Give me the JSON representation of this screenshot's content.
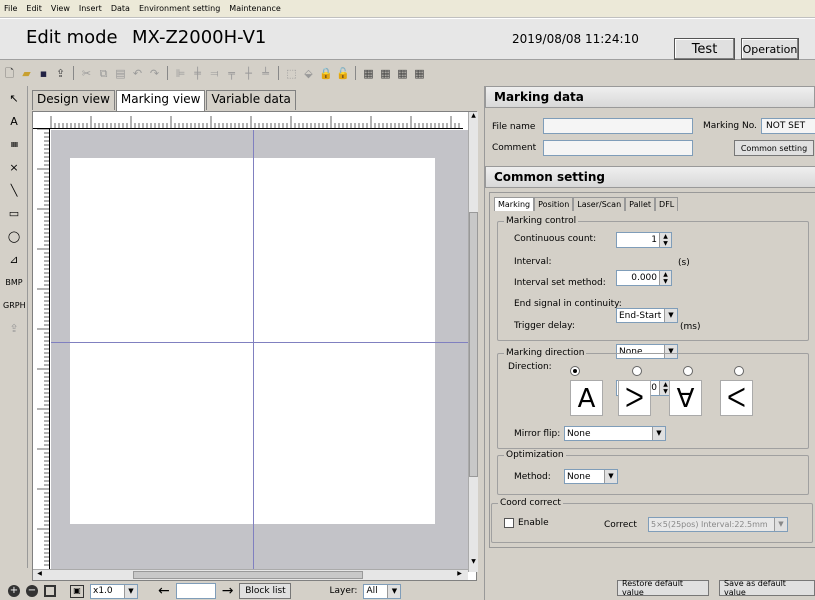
{
  "menu": [
    "File",
    "Edit",
    "View",
    "Insert",
    "Data",
    "Environment setting",
    "Maintenance"
  ],
  "header": {
    "mode": "Edit mode",
    "model": "MX-Z2000H-V1",
    "datetime": "2019/08/08 11:24:10",
    "test_label": "Test",
    "operation_label": "Operation"
  },
  "left_tools": [
    "A",
    "IIIIII",
    "×",
    "╲",
    "▭",
    "◯",
    "⊿",
    "BMP",
    "GRPH"
  ],
  "view_tabs": [
    "Design view",
    "Marking view",
    "Variable data"
  ],
  "bottom": {
    "zoom": "x1.0",
    "block_list_label": "Block list",
    "layer_label": "Layer:",
    "layer_value": "All"
  },
  "marking_data": {
    "title": "Marking data",
    "file_name_label": "File name",
    "file_name_value": "",
    "marking_no_label": "Marking No.",
    "marking_no_value": "NOT SET",
    "comment_label": "Comment",
    "comment_value": "",
    "common_setting_button": "Common setting"
  },
  "common_setting": {
    "title": "Common setting",
    "tabs": [
      "Marking",
      "Position",
      "Laser/Scan",
      "Pallet",
      "DFL"
    ],
    "marking_control": {
      "title": "Marking control",
      "continuous_count_label": "Continuous count:",
      "continuous_count_value": "1",
      "interval_label": "Interval:",
      "interval_value": "0.000",
      "interval_unit": "(s)",
      "interval_method_label": "Interval set method:",
      "interval_method_value": "End-Start",
      "end_signal_label": "End signal in continuity:",
      "end_signal_value": "None",
      "trigger_delay_label": "Trigger delay:",
      "trigger_delay_value": "10",
      "trigger_delay_unit": "(ms)"
    },
    "marking_direction": {
      "title": "Marking direction",
      "direction_label": "Direction:",
      "directions": [
        "A",
        "ᐳ",
        "∀",
        "ᐸ"
      ],
      "selected_index": 0,
      "mirror_flip_label": "Mirror flip:",
      "mirror_flip_value": "None"
    },
    "optimization": {
      "title": "Optimization",
      "method_label": "Method:",
      "method_value": "None"
    },
    "coord_correct": {
      "title": "Coord correct",
      "enable_label": "Enable",
      "correct_label": "Correct",
      "correct_value": "5×5(25pos) Interval:22.5mm"
    }
  },
  "footer": {
    "restore_label": "Restore default value",
    "save_default_label": "Save as default value"
  }
}
